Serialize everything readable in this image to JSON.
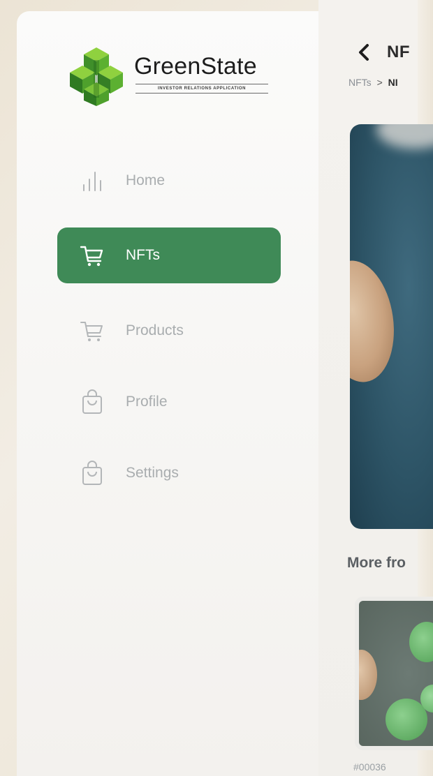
{
  "colors": {
    "accent": "#3f8a57",
    "nav_inactive": "#a9adaf",
    "brand_green": "#4aa833"
  },
  "brand": {
    "name": "GreenState",
    "tagline": "INVESTOR RELATIONS APPLICATION",
    "logo_icon": "green-cubes-logo"
  },
  "sidebar": {
    "items": [
      {
        "label": "Home",
        "icon": "bar-chart-icon",
        "active": false
      },
      {
        "label": "NFTs",
        "icon": "shopping-cart-icon",
        "active": true
      },
      {
        "label": "Products",
        "icon": "shopping-cart-icon",
        "active": false
      },
      {
        "label": "Profile",
        "icon": "shopping-bag-icon",
        "active": false
      },
      {
        "label": "Settings",
        "icon": "shopping-bag-icon",
        "active": false
      }
    ]
  },
  "content": {
    "title": "NF",
    "breadcrumb": {
      "root": "NFTs",
      "separator": ">",
      "current": "NI"
    },
    "more_title": "More fro",
    "thumb_id": "#00036"
  }
}
